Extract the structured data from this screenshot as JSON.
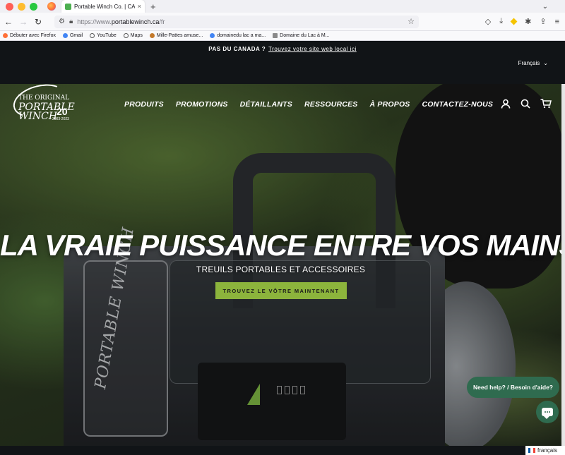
{
  "browser": {
    "tab": {
      "title": "Portable Winch Co. | CANADA -",
      "close": "×"
    },
    "new_tab": "+",
    "tab_overflow": "⌄",
    "url_prefix": "https://www.",
    "url_domain": "portablewinch.ca",
    "url_path": "/fr",
    "bookmarks": [
      {
        "label": "Débuter avec Firefox",
        "icon": "firefox-icon",
        "color": "#ff7139"
      },
      {
        "label": "Gmail",
        "icon": "google-icon",
        "color": "#4285f4"
      },
      {
        "label": "YouTube",
        "icon": "globe-icon",
        "color": "#555555"
      },
      {
        "label": "Maps",
        "icon": "globe-icon",
        "color": "#555555"
      },
      {
        "label": "Mille-Pattes amuse...",
        "icon": "mille-pattes-icon",
        "color": "#c47a2c"
      },
      {
        "label": "domainedu lac a ma...",
        "icon": "google-icon",
        "color": "#4285f4"
      },
      {
        "label": "Domaine du Lac à M...",
        "icon": "page-icon",
        "color": "#8a8a8a"
      }
    ]
  },
  "announcement": {
    "question": "PAS DU CANADA ?",
    "link": "Trouvez votre site web local ici"
  },
  "language": {
    "selected": "Français"
  },
  "nav": {
    "items": [
      "PRODUITS",
      "PROMOTIONS",
      "DÉTAILLANTS",
      "RESSOURCES",
      "À PROPOS",
      "CONTACTEZ-NOUS"
    ]
  },
  "logo": {
    "tagline": "THE ORIGINAL",
    "word1": "PORTABLE",
    "word2": "WINCH",
    "anniversary": "20",
    "years": "2003-2023"
  },
  "hero": {
    "title": "LA VRAIE PUISSANCE ENTRE VOS MAINS",
    "subtitle": "TREUILS PORTABLES ET ACCESSOIRES",
    "cta": "TROUVEZ LE VÔTRE MAINTENANT",
    "product_logo": "PORTABLE WINCH"
  },
  "chat": {
    "bubble": "Need help? / Besoin d'aide?"
  },
  "language_widget": {
    "label": "français"
  },
  "colors": {
    "accent_green": "#8cb43c",
    "chat_green": "#2f6b4f",
    "dark_bar": "#111417"
  }
}
